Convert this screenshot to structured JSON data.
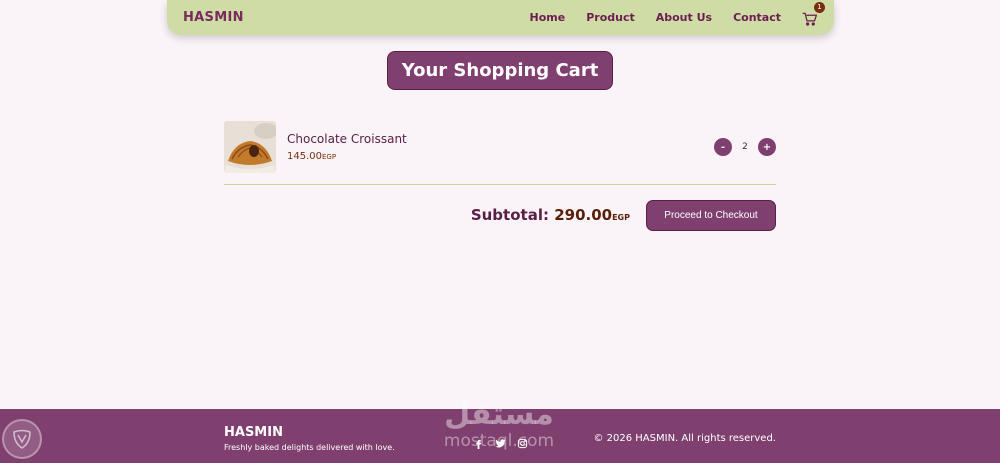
{
  "nav": {
    "brand": "HASMIN",
    "links": [
      "Home",
      "Product",
      "About Us",
      "Contact"
    ],
    "cart_count": "1",
    "cart_icon": "cart-icon"
  },
  "page_title": "Your Shopping Cart",
  "cart": {
    "items": [
      {
        "name": "Chocolate Croissant",
        "price": "145.00",
        "currency": "EGP",
        "quantity": "2",
        "decrement_label": "-",
        "increment_label": "+"
      }
    ],
    "subtotal_label": "Subtotal:",
    "subtotal_value": "290.00",
    "subtotal_currency": "EGP",
    "checkout_label": "Proceed to Checkout"
  },
  "footer": {
    "brand": "HASMIN",
    "tagline": "Freshly baked delights delivered with love.",
    "socials": [
      "facebook-icon",
      "twitter-icon",
      "instagram-icon"
    ],
    "copyright": "© 2026 HASMIN. All rights reserved."
  },
  "watermark": {
    "arabic": "مستقل",
    "latin": "mostaql.com"
  },
  "colors": {
    "navbar": "#cfdca6",
    "accent": "#80406f",
    "background": "#faf4f8",
    "price": "#7a2e0e"
  }
}
